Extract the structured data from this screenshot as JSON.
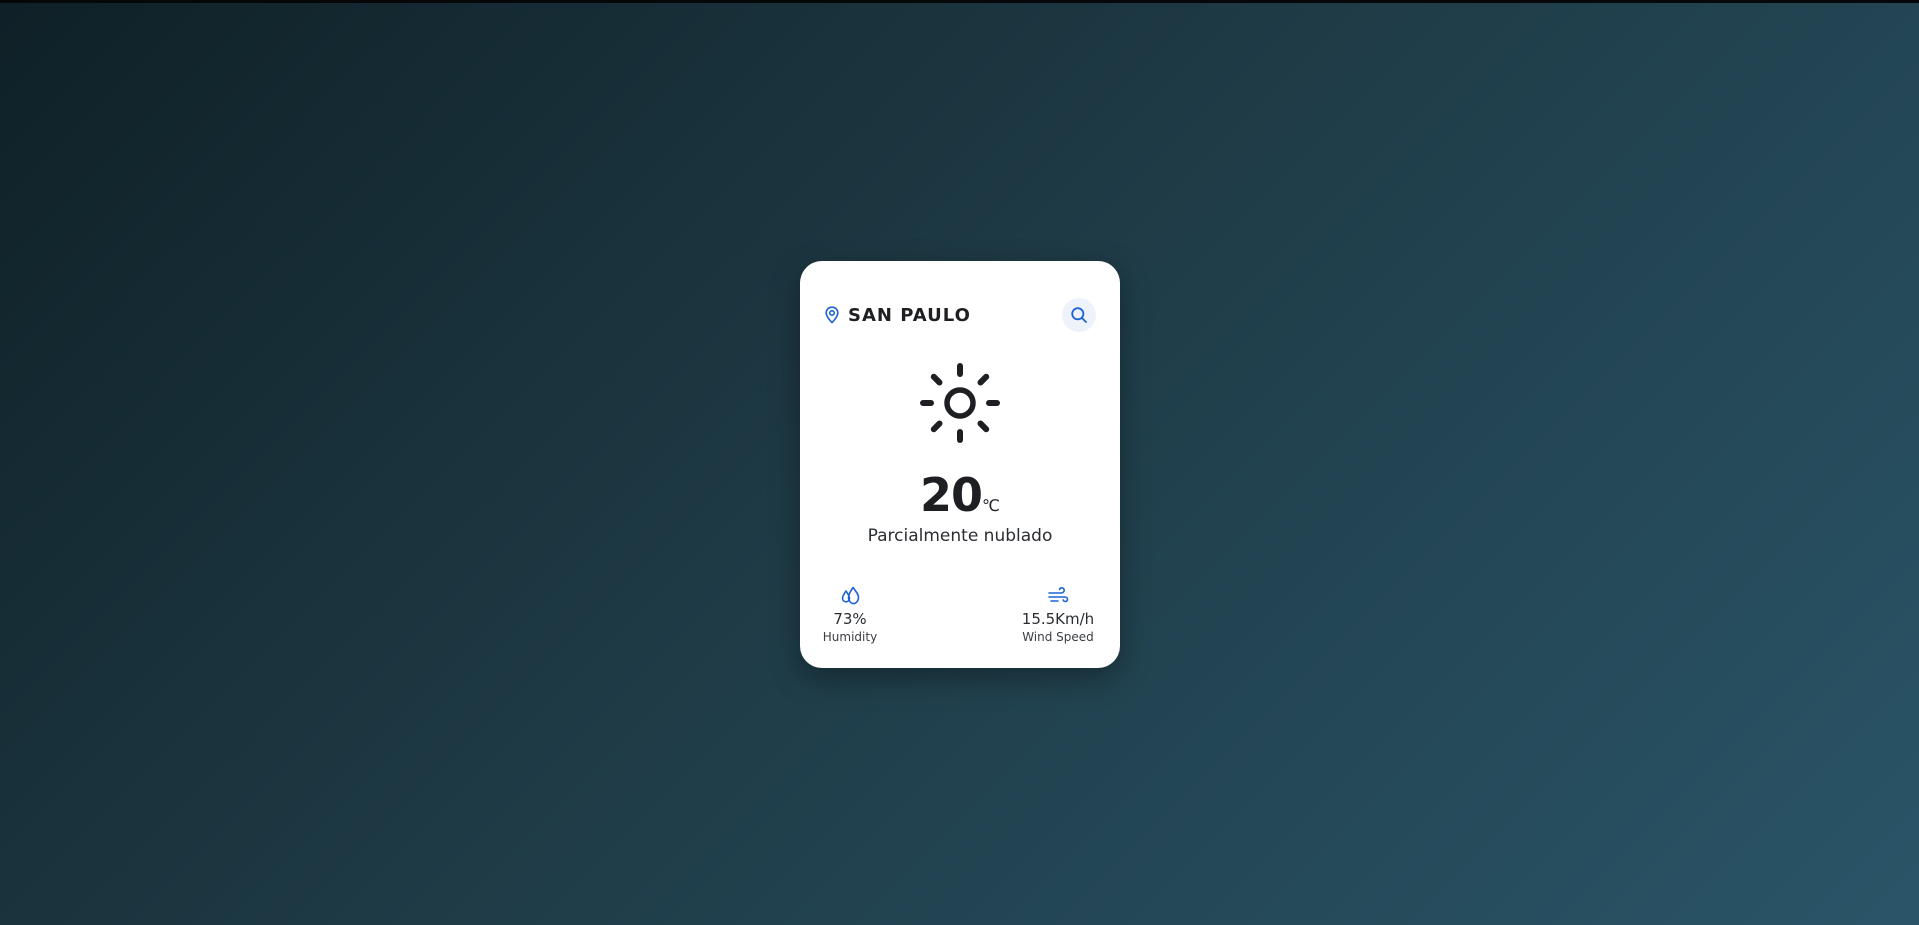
{
  "location": {
    "city": "SAN PAULO",
    "icon": "map-pin-icon"
  },
  "search": {
    "icon": "search-icon"
  },
  "weather": {
    "icon": "sun-icon",
    "temperature": "20",
    "unit": "℃",
    "condition": "Parcialmente nublado"
  },
  "stats": {
    "humidity": {
      "icon": "humidity-drops-icon",
      "value": "73%",
      "label": "Humidity"
    },
    "wind": {
      "icon": "wind-icon",
      "value": "15.5Km/h",
      "label": "Wind Speed"
    }
  },
  "colors": {
    "accent": "#1e63d6",
    "text": "#1d1f22",
    "card": "#ffffff"
  }
}
